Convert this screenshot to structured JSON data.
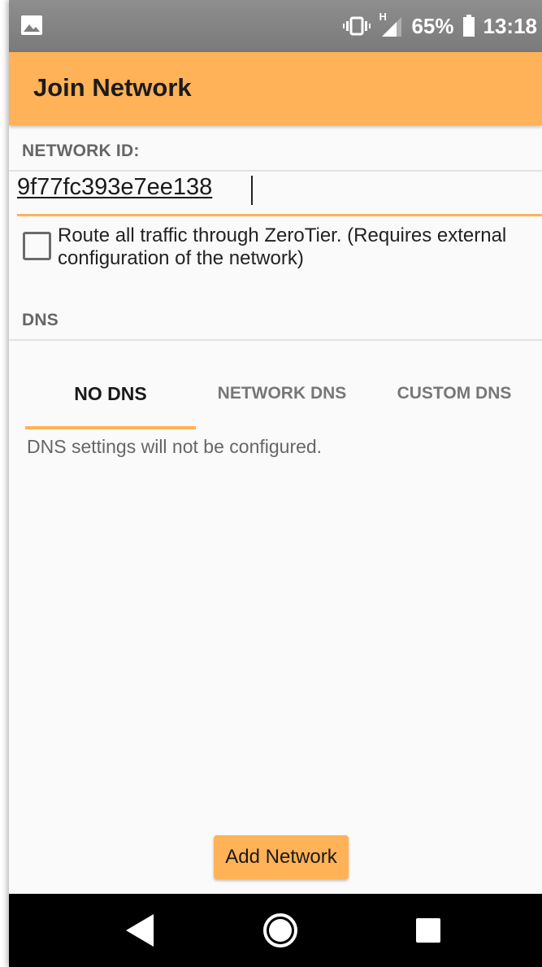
{
  "status_bar": {
    "icons": [
      "image-icon",
      "vibrate-icon",
      "signal-icon",
      "battery-icon"
    ],
    "signal_type": "H",
    "battery": "65%",
    "time": "13:18"
  },
  "app_bar": {
    "title": "Join Network"
  },
  "network_id": {
    "header": "NETWORK ID:",
    "value": "9f77fc393e7ee138"
  },
  "route_all": {
    "checked": false,
    "label": "Route all traffic through ZeroTier. (Requires external configuration of the network)"
  },
  "dns": {
    "header": "DNS",
    "tabs": [
      {
        "label": "NO DNS",
        "selected": true
      },
      {
        "label": "NETWORK DNS",
        "selected": false
      },
      {
        "label": "CUSTOM DNS",
        "selected": false
      }
    ],
    "description": "DNS settings will not be configured."
  },
  "actions": {
    "add_label": "Add Network"
  },
  "nav_bar": {
    "icons": [
      "back-icon",
      "home-icon",
      "recents-icon"
    ]
  },
  "colors": {
    "accent": "#ffb257",
    "status_bar": "#858585",
    "nav_bar": "#000000"
  }
}
